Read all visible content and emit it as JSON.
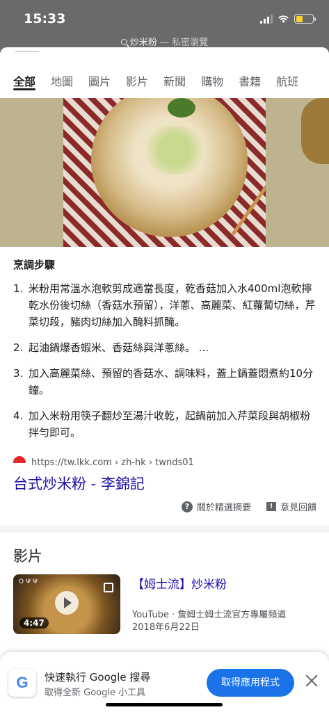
{
  "status_bar": {
    "time": "15:33"
  },
  "url_bar": {
    "query": "炒米粉",
    "mode": " — 私密瀏覽"
  },
  "tabs": [
    {
      "label": "全部",
      "active": true
    },
    {
      "label": "地圖"
    },
    {
      "label": "圖片"
    },
    {
      "label": "影片"
    },
    {
      "label": "新聞"
    },
    {
      "label": "購物"
    },
    {
      "label": "書籍"
    },
    {
      "label": "航班"
    }
  ],
  "snippet": {
    "title": "烹調步驟",
    "steps": [
      {
        "num": "1.",
        "text": "米粉用常溫水泡軟剪成適當長度，乾香菇加入水400ml泡軟擰乾水份後切絲（香菇水預留），洋蔥、高麗菜、紅蘿蔔切絲，芹菜切段，豬肉切絲加入醃料抓醃。"
      },
      {
        "num": "2.",
        "text": "起油鍋爆香蝦米、香菇絲與洋蔥絲。 ..."
      },
      {
        "num": "3.",
        "text": "加入高麗菜絲、預留的香菇水、調味料，蓋上鍋蓋悶煮約10分鐘。"
      },
      {
        "num": "4.",
        "text": "加入米粉用筷子翻炒至湯汁收乾，起鍋前加入芹菜段與胡椒粉拌勻即可。"
      }
    ],
    "source_url": "https://tw.lkk.com › zh-hk › twnds01",
    "source_title": "台式炒米粉 - 李錦記",
    "about_label": "關於精選摘要",
    "feedback_label": "意見回饋"
  },
  "videos": {
    "heading": "影片",
    "items": [
      {
        "thumb_label": "Ο Ψ Ψ",
        "duration": "4:47",
        "title": "【姆士流】炒米粉",
        "channel": "YouTube · 詹姆士姆士流官方專屬頻道",
        "date": "2018年6月22日"
      }
    ]
  },
  "banner": {
    "logo": "G",
    "title": "快速執行 Google 搜尋",
    "subtitle": "取得全新 Google 小工具",
    "button": "取得應用程式"
  },
  "colors": {
    "link": "#1a0dab",
    "button": "#1a73e8",
    "header": "#6a6a6a"
  }
}
